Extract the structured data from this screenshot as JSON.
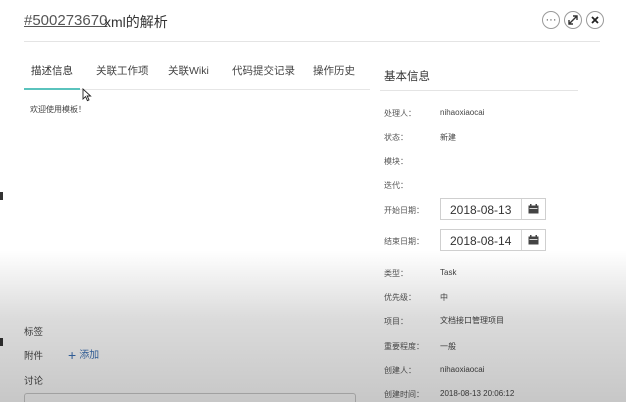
{
  "header": {
    "task_id": "#500273670",
    "task_title": "xml的解析"
  },
  "tabs": [
    {
      "label": "描述信息",
      "active": true
    },
    {
      "label": "关联工作项",
      "active": false
    },
    {
      "label": "关联Wiki",
      "active": false
    },
    {
      "label": "代码提交记录",
      "active": false
    },
    {
      "label": "操作历史",
      "active": false
    }
  ],
  "description": "欢迎使用模板！",
  "bottom": {
    "tags_label": "标签",
    "attachments_label": "附件",
    "add_label": "添加",
    "discussion_label": "讨论"
  },
  "sidebar": {
    "title": "基本信息",
    "fields": {
      "assignee": {
        "label": "处理人：",
        "value": "nihaoxiaocai"
      },
      "status": {
        "label": "状态：",
        "value": "新建"
      },
      "module": {
        "label": "模块：",
        "value": ""
      },
      "iteration": {
        "label": "迭代：",
        "value": ""
      },
      "start_date": {
        "label": "开始日期：",
        "value": "2018-08-13"
      },
      "end_date": {
        "label": "结束日期：",
        "value": "2018-08-14"
      },
      "type": {
        "label": "类型：",
        "value": "Task"
      },
      "priority": {
        "label": "优先级：",
        "value": "中"
      },
      "project": {
        "label": "项目：",
        "value": "文档接口管理项目"
      },
      "severity": {
        "label": "重要程度：",
        "value": "一般"
      },
      "creator": {
        "label": "创建人：",
        "value": "nihaoxiaocai"
      },
      "created_at": {
        "label": "创建时间：",
        "value": "2018-08-13 20:06:12"
      }
    }
  },
  "icons": {
    "more": "more-icon",
    "expand": "expand-icon",
    "close": "close-icon",
    "calendar": "calendar-icon",
    "plus": "plus-icon"
  },
  "colors": {
    "tab_active_underline": "#5ac3bd",
    "link": "#3a6fb3"
  }
}
